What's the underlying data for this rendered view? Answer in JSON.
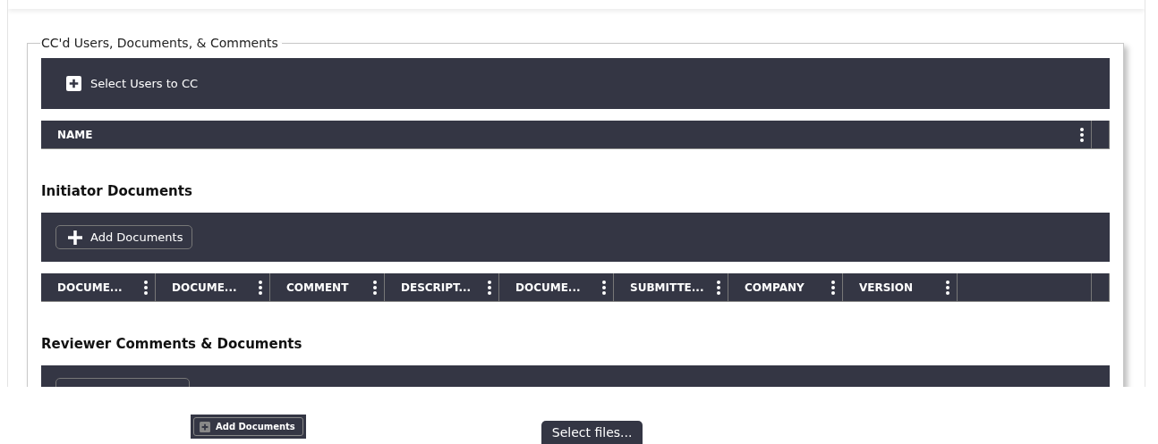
{
  "fieldset": {
    "legend": "CC'd Users, Documents, & Comments",
    "cc_users": {
      "button": "Select Users to CC",
      "columns": [
        "NAME"
      ]
    },
    "initiator_documents": {
      "heading": "Initiator Documents",
      "button": "Add Documents",
      "columns": [
        "DOCUME...",
        "DOCUME...",
        "COMMENT",
        "DESCRIPT...",
        "DOCUME...",
        "SUBMITTE...",
        "COMPANY",
        "VERSION"
      ]
    },
    "reviewer_documents": {
      "heading": "Reviewer Comments & Documents"
    }
  },
  "drag_preview": {
    "button": "Add Documents"
  },
  "upload": {
    "button": "Select files..."
  }
}
